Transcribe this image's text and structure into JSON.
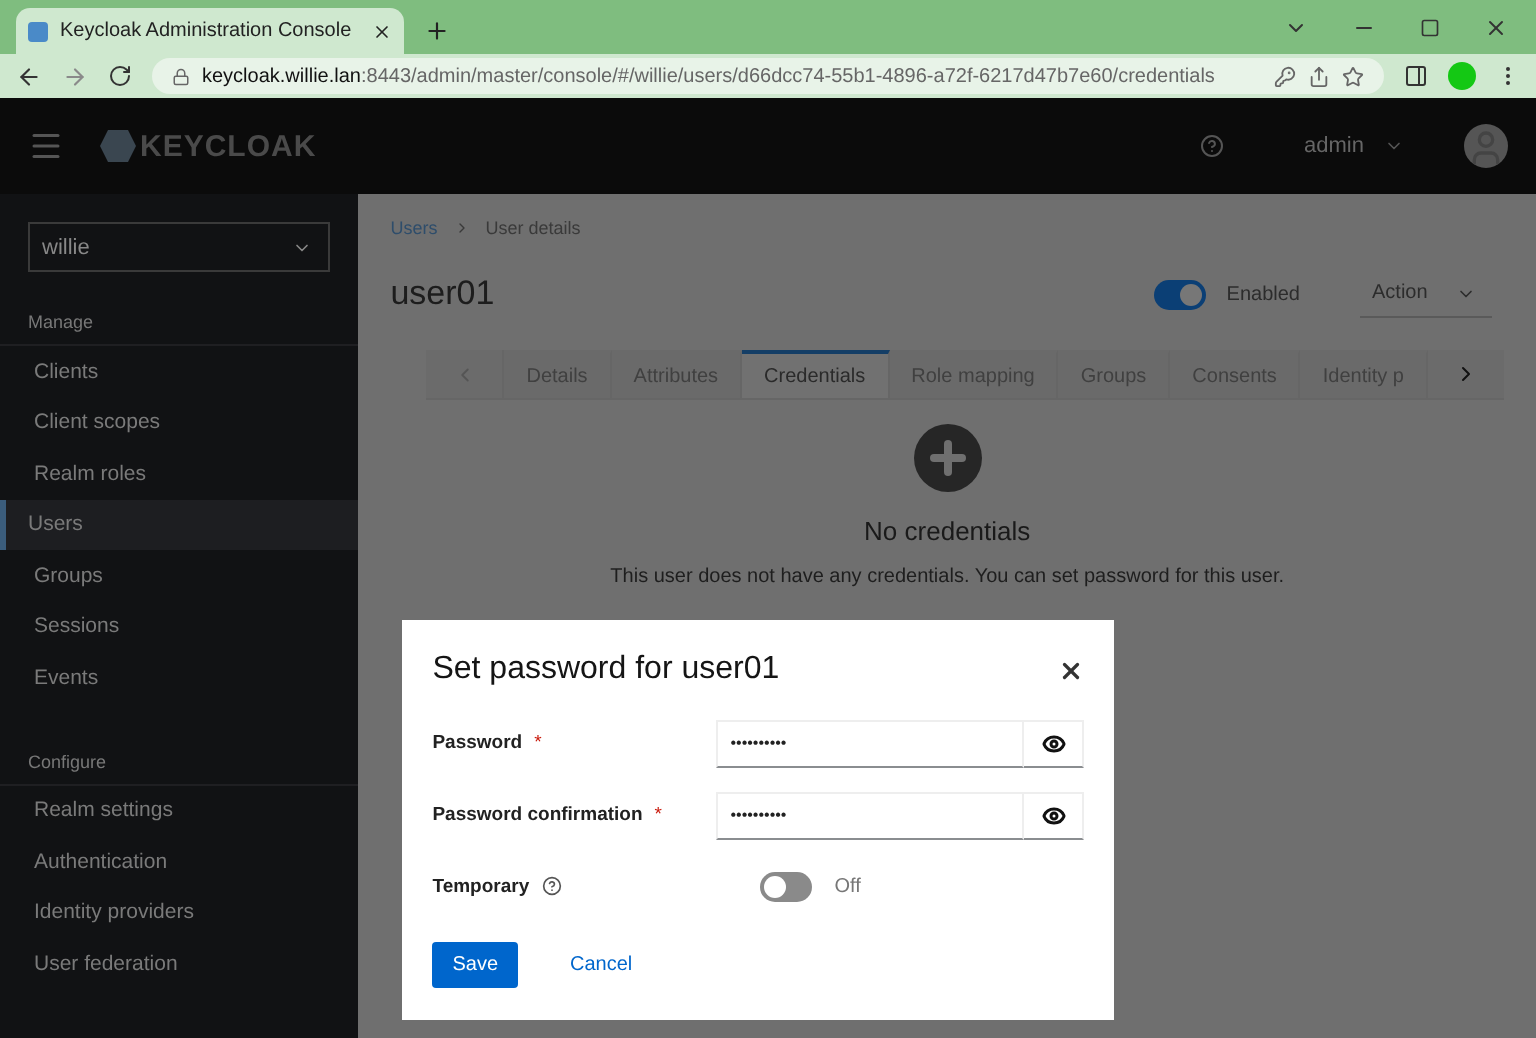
{
  "browser": {
    "tab_title": "Keycloak Administration Console",
    "url_host": "keycloak.willie.lan",
    "url_rest": ":8443/admin/master/console/#/willie/users/d66dcc74-55b1-4896-a72f-6217d47b7e60/credentials"
  },
  "header": {
    "logo": "KEYCLOAK",
    "user": "admin"
  },
  "sidebar": {
    "realm": "willie",
    "sections": [
      {
        "title": "Manage",
        "items": [
          {
            "label": "Clients",
            "selected": false
          },
          {
            "label": "Client scopes",
            "selected": false
          },
          {
            "label": "Realm roles",
            "selected": false
          },
          {
            "label": "Users",
            "selected": true
          },
          {
            "label": "Groups",
            "selected": false
          },
          {
            "label": "Sessions",
            "selected": false
          },
          {
            "label": "Events",
            "selected": false
          }
        ]
      },
      {
        "title": "Configure",
        "items": [
          {
            "label": "Realm settings",
            "selected": false
          },
          {
            "label": "Authentication",
            "selected": false
          },
          {
            "label": "Identity providers",
            "selected": false
          },
          {
            "label": "User federation",
            "selected": false
          }
        ]
      }
    ]
  },
  "breadcrumb": [
    {
      "label": "Users",
      "link": true
    },
    {
      "label": "User details",
      "link": false
    }
  ],
  "title": "user01",
  "enabled": {
    "label": "Enabled",
    "on": true
  },
  "action": "Action",
  "tabs": [
    {
      "label": "Details",
      "selected": false
    },
    {
      "label": "Attributes",
      "selected": false
    },
    {
      "label": "Credentials",
      "selected": true
    },
    {
      "label": "Role mapping",
      "selected": false
    },
    {
      "label": "Groups",
      "selected": false
    },
    {
      "label": "Consents",
      "selected": false
    },
    {
      "label": "Identity p",
      "selected": false
    }
  ],
  "empty": {
    "title": "No credentials",
    "text": "This user does not have any credentials. You can set password for this user."
  },
  "dialog": {
    "title": "Set password for user01",
    "fields": [
      {
        "label": "Password",
        "required_mark": "*",
        "value": "••••••••••"
      },
      {
        "label": "Password confirmation",
        "required_mark": "*",
        "value": "••••••••••"
      }
    ],
    "temporary": {
      "label": "Temporary",
      "on": false,
      "state_text": "Off"
    },
    "buttons": [
      {
        "label": "Save",
        "kind": "primary"
      },
      {
        "label": "Cancel",
        "kind": "link"
      }
    ]
  }
}
